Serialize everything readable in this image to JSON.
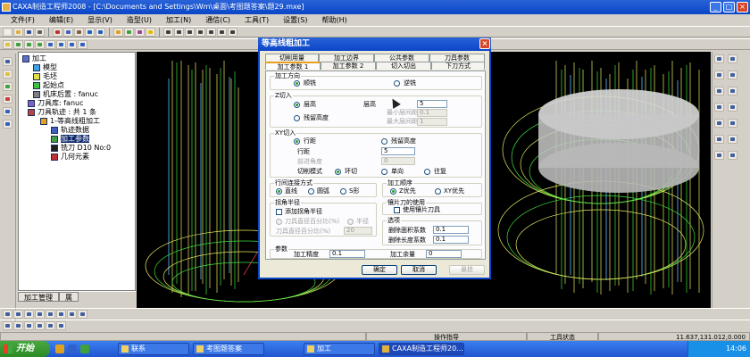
{
  "window": {
    "title": "CAXA制造工程师2008 - [C:\\Documents and Settings\\Wm\\桌面\\考图题答案\\题29.mxe]"
  },
  "menu": [
    "文件(F)",
    "编辑(E)",
    "显示(V)",
    "造型(U)",
    "加工(N)",
    "通信(C)",
    "工具(T)",
    "设置(S)",
    "帮助(H)"
  ],
  "tree": {
    "root": "加工",
    "model": "模型",
    "blank": "毛坯",
    "start_point": "起始点",
    "post": "机床后置 : fanuc",
    "tool_lib": "刀具库: fanuc",
    "paths": "刀具轨迹 : 共 1 条",
    "op1": "1-等高线粗加工",
    "traj": "轨迹数据",
    "params": "加工参数",
    "tool": "铣刀 D10 No:0",
    "geom": "几何元素"
  },
  "panel_tabs": [
    "加工管理",
    "属"
  ],
  "dialog": {
    "title": "等高线粗加工",
    "tabs_row1": [
      "切削用量",
      "加工边界",
      "公共参数",
      "刀具参数"
    ],
    "tabs_row2": [
      "加工参数 1",
      "加工参数 2",
      "切入切出",
      "下刀方式"
    ],
    "dir_group": "加工方向",
    "dir_climb": "顺铣",
    "dir_conv": "逆铣",
    "z_group": "Z切入",
    "z_layer_height": "层高",
    "z_residual": "残留高度",
    "layer_height_label": "层高",
    "layer_height_value": "5",
    "min_layer_label": "最小层间距",
    "min_layer_value": "0.1",
    "max_layer_label": "最大层间距",
    "max_layer_value": "1",
    "xy_group": "XY切入",
    "xy_row_dist": "行距",
    "xy_residual": "残留高度",
    "row_dist_label": "行距",
    "row_dist_value": "5",
    "cut_angle_label": "前进角度",
    "cut_angle_value": "0",
    "cut_mode_label": "切削模式",
    "mode_loop": "环切",
    "mode_one": "单向",
    "mode_zigzag": "往复",
    "link_group": "行间连接方式",
    "link_line": "直线",
    "link_arc": "圆弧",
    "link_s": "S形",
    "order_group": "加工顺序",
    "order_z": "Z优先",
    "order_xy": "XY优先",
    "corner_group": "拐角半径",
    "corner_add": "添加拐角半径",
    "corner_tool_pct": "刀具直径百分比(%)",
    "corner_radius": "半径",
    "corner_pct_label": "刀具直径百分比(%)",
    "corner_pct_value": "20",
    "blade_group": "镶片刀的使用",
    "blade_use": "使用镶片刀具",
    "opt_group": "选项",
    "min_area_label": "删除面积系数",
    "min_area_value": "0.1",
    "min_len_label": "删除长度系数",
    "min_len_value": "0.1",
    "param_group": "参数",
    "precision_label": "加工精度",
    "precision_value": "0.1",
    "allowance_label": "加工余量",
    "allowance_value": "0",
    "ok": "确定",
    "cancel": "取消",
    "pause": "悬挂"
  },
  "status": {
    "hint": "操作指导",
    "state": "工具状态",
    "coords": "11.637,131.012,0.000"
  },
  "taskbar": {
    "start": "开始",
    "tasks": [
      "联系",
      "考图题答案",
      "加工",
      "CAXA制造工程师20..."
    ],
    "clock": "14:06"
  }
}
